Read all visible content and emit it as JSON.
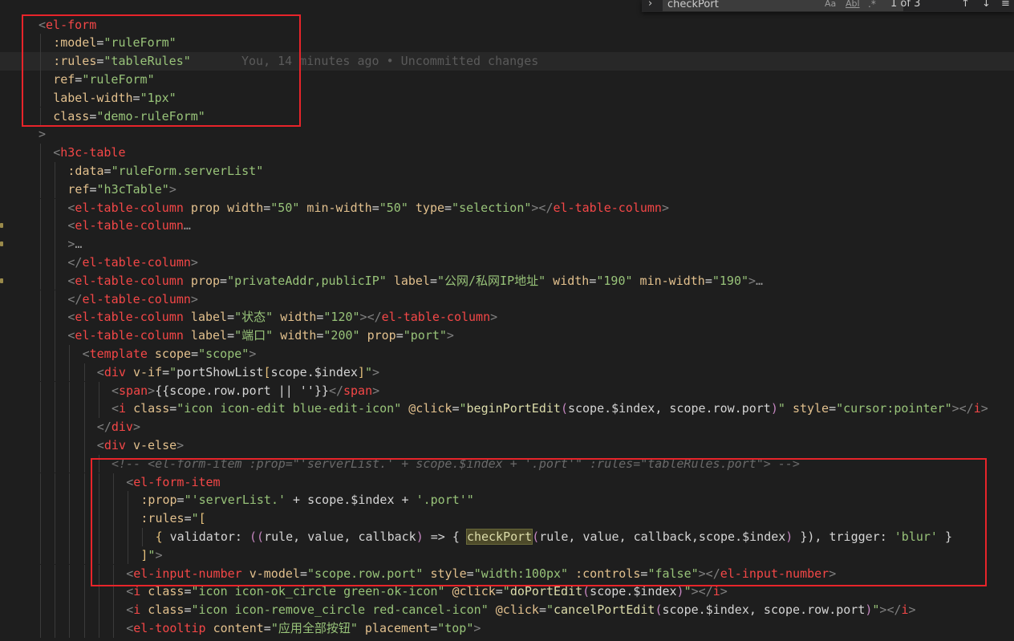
{
  "find_widget": {
    "toggle_icon": "chevron-right-icon",
    "query": "checkPort",
    "match_case_label": "Aa",
    "whole_word_label": "Abl",
    "regex_icon": "regex-icon",
    "result_count": "1 of 3",
    "prev_icon": "arrow-up-icon",
    "next_icon": "arrow-down-icon",
    "menu_icon": "hamburger-icon"
  },
  "blame": {
    "text": "You, 14 minutes ago • Uncommitted changes"
  },
  "code_lines": [
    {
      "indent": 0,
      "tokens": [
        [
          "punc",
          "<"
        ],
        [
          "tag",
          "el-form"
        ]
      ]
    },
    {
      "indent": 1,
      "tokens": [
        [
          "attr",
          ":model"
        ],
        [
          "eq",
          "="
        ],
        [
          "str",
          "\"ruleForm\""
        ]
      ]
    },
    {
      "indent": 1,
      "tokens": [
        [
          "attr",
          ":rules"
        ],
        [
          "eq",
          "="
        ],
        [
          "str",
          "\"tableRules\""
        ]
      ],
      "blame": true
    },
    {
      "indent": 1,
      "tokens": [
        [
          "attr",
          "ref"
        ],
        [
          "eq",
          "="
        ],
        [
          "str",
          "\"ruleForm\""
        ]
      ]
    },
    {
      "indent": 1,
      "tokens": [
        [
          "attr",
          "label-width"
        ],
        [
          "eq",
          "="
        ],
        [
          "str",
          "\"1px\""
        ]
      ]
    },
    {
      "indent": 1,
      "tokens": [
        [
          "attr",
          "class"
        ],
        [
          "eq",
          "="
        ],
        [
          "str",
          "\"demo-ruleForm\""
        ]
      ]
    },
    {
      "indent": 0,
      "tokens": [
        [
          "punc",
          ">"
        ]
      ]
    },
    {
      "indent": 1,
      "tokens": [
        [
          "punc",
          "<"
        ],
        [
          "tag",
          "h3c-table"
        ]
      ]
    },
    {
      "indent": 2,
      "tokens": [
        [
          "attr",
          ":data"
        ],
        [
          "eq",
          "="
        ],
        [
          "str",
          "\"ruleForm.serverList\""
        ]
      ]
    },
    {
      "indent": 2,
      "tokens": [
        [
          "attr",
          "ref"
        ],
        [
          "eq",
          "="
        ],
        [
          "str",
          "\"h3cTable\""
        ],
        [
          "punc",
          ">"
        ]
      ]
    },
    {
      "indent": 2,
      "tokens": [
        [
          "punc",
          "<"
        ],
        [
          "tag",
          "el-table-column"
        ],
        [
          "plain",
          " "
        ],
        [
          "attr",
          "prop"
        ],
        [
          "plain",
          " "
        ],
        [
          "attr",
          "width"
        ],
        [
          "eq",
          "="
        ],
        [
          "str",
          "\"50\""
        ],
        [
          "plain",
          " "
        ],
        [
          "attr",
          "min-width"
        ],
        [
          "eq",
          "="
        ],
        [
          "str",
          "\"50\""
        ],
        [
          "plain",
          " "
        ],
        [
          "attr",
          "type"
        ],
        [
          "eq",
          "="
        ],
        [
          "str",
          "\"selection\""
        ],
        [
          "punc",
          "></"
        ],
        [
          "tag",
          "el-table-column"
        ],
        [
          "punc",
          ">"
        ]
      ]
    },
    {
      "indent": 2,
      "tokens": [
        [
          "punc",
          "<"
        ],
        [
          "tag",
          "el-table-column"
        ],
        [
          "ellipsis",
          "…"
        ]
      ],
      "fold": true
    },
    {
      "indent": 2,
      "tokens": [
        [
          "punc",
          ">"
        ],
        [
          "ellipsis",
          "…"
        ]
      ],
      "fold": true
    },
    {
      "indent": 2,
      "tokens": [
        [
          "punc",
          "</"
        ],
        [
          "tag",
          "el-table-column"
        ],
        [
          "punc",
          ">"
        ]
      ]
    },
    {
      "indent": 2,
      "tokens": [
        [
          "punc",
          "<"
        ],
        [
          "tag",
          "el-table-column"
        ],
        [
          "plain",
          " "
        ],
        [
          "attr",
          "prop"
        ],
        [
          "eq",
          "="
        ],
        [
          "str",
          "\"privateAddr,publicIP\""
        ],
        [
          "plain",
          " "
        ],
        [
          "attr",
          "label"
        ],
        [
          "eq",
          "="
        ],
        [
          "str",
          "\"公网/私网IP地址\""
        ],
        [
          "plain",
          " "
        ],
        [
          "attr",
          "width"
        ],
        [
          "eq",
          "="
        ],
        [
          "str",
          "\"190\""
        ],
        [
          "plain",
          " "
        ],
        [
          "attr",
          "min-width"
        ],
        [
          "eq",
          "="
        ],
        [
          "str",
          "\"190\""
        ],
        [
          "punc",
          ">"
        ],
        [
          "ellipsis",
          "…"
        ]
      ],
      "fold": true
    },
    {
      "indent": 2,
      "tokens": [
        [
          "punc",
          "</"
        ],
        [
          "tag",
          "el-table-column"
        ],
        [
          "punc",
          ">"
        ]
      ]
    },
    {
      "indent": 2,
      "tokens": [
        [
          "punc",
          "<"
        ],
        [
          "tag",
          "el-table-column"
        ],
        [
          "plain",
          " "
        ],
        [
          "attr",
          "label"
        ],
        [
          "eq",
          "="
        ],
        [
          "str",
          "\"状态\""
        ],
        [
          "plain",
          " "
        ],
        [
          "attr",
          "width"
        ],
        [
          "eq",
          "="
        ],
        [
          "str",
          "\"120\""
        ],
        [
          "punc",
          "></"
        ],
        [
          "tag",
          "el-table-column"
        ],
        [
          "punc",
          ">"
        ]
      ]
    },
    {
      "indent": 2,
      "tokens": [
        [
          "punc",
          "<"
        ],
        [
          "tag",
          "el-table-column"
        ],
        [
          "plain",
          " "
        ],
        [
          "attr",
          "label"
        ],
        [
          "eq",
          "="
        ],
        [
          "str",
          "\"端口\""
        ],
        [
          "plain",
          " "
        ],
        [
          "attr",
          "width"
        ],
        [
          "eq",
          "="
        ],
        [
          "str",
          "\"200\""
        ],
        [
          "plain",
          " "
        ],
        [
          "attr",
          "prop"
        ],
        [
          "eq",
          "="
        ],
        [
          "str",
          "\"port\""
        ],
        [
          "punc",
          ">"
        ]
      ]
    },
    {
      "indent": 3,
      "tokens": [
        [
          "punc",
          "<"
        ],
        [
          "tag",
          "template"
        ],
        [
          "plain",
          " "
        ],
        [
          "attr",
          "scope"
        ],
        [
          "eq",
          "="
        ],
        [
          "str",
          "\"scope\""
        ],
        [
          "punc",
          ">"
        ]
      ]
    },
    {
      "indent": 4,
      "tokens": [
        [
          "punc",
          "<"
        ],
        [
          "tag",
          "div"
        ],
        [
          "plain",
          " "
        ],
        [
          "attr",
          "v-if"
        ],
        [
          "eq",
          "="
        ],
        [
          "str",
          "\""
        ],
        [
          "plain",
          "portShowList"
        ],
        [
          "hl",
          "["
        ],
        [
          "plain",
          "scope.$index"
        ],
        [
          "hl",
          "]"
        ],
        [
          "str",
          "\""
        ],
        [
          "punc",
          ">"
        ]
      ]
    },
    {
      "indent": 5,
      "tokens": [
        [
          "punc",
          "<"
        ],
        [
          "tag",
          "span"
        ],
        [
          "punc",
          ">"
        ],
        [
          "plain",
          "{{scope.row.port || ''}}"
        ],
        [
          "punc",
          "</"
        ],
        [
          "tag",
          "span"
        ],
        [
          "punc",
          ">"
        ]
      ]
    },
    {
      "indent": 5,
      "tokens": [
        [
          "punc",
          "<"
        ],
        [
          "tag",
          "i"
        ],
        [
          "plain",
          " "
        ],
        [
          "attr",
          "class"
        ],
        [
          "eq",
          "="
        ],
        [
          "str",
          "\"icon icon-edit blue-edit-icon\""
        ],
        [
          "plain",
          " "
        ],
        [
          "attr",
          "@click"
        ],
        [
          "eq",
          "="
        ],
        [
          "str",
          "\""
        ],
        [
          "fn",
          "beginPortEdit"
        ],
        [
          "paren",
          "("
        ],
        [
          "plain",
          "scope.$index, scope.row.port"
        ],
        [
          "paren",
          ")"
        ],
        [
          "str",
          "\""
        ],
        [
          "plain",
          " "
        ],
        [
          "attr",
          "style"
        ],
        [
          "eq",
          "="
        ],
        [
          "str",
          "\"cursor:pointer\""
        ],
        [
          "punc",
          "></"
        ],
        [
          "tag",
          "i"
        ],
        [
          "punc",
          ">"
        ]
      ]
    },
    {
      "indent": 4,
      "tokens": [
        [
          "punc",
          "</"
        ],
        [
          "tag",
          "div"
        ],
        [
          "punc",
          ">"
        ]
      ]
    },
    {
      "indent": 4,
      "tokens": [
        [
          "punc",
          "<"
        ],
        [
          "tag",
          "div"
        ],
        [
          "plain",
          " "
        ],
        [
          "attr",
          "v-else"
        ],
        [
          "punc",
          ">"
        ]
      ]
    },
    {
      "indent": 5,
      "tokens": [
        [
          "comment",
          "<!-- <el-form-item :prop=\"'serverList.' + scope.$index + '.port'\" :rules=\"tableRules.port\"> -->"
        ]
      ]
    },
    {
      "indent": 6,
      "tokens": [
        [
          "punc",
          "<"
        ],
        [
          "tag",
          "el-form-item"
        ]
      ]
    },
    {
      "indent": 7,
      "tokens": [
        [
          "attr",
          ":prop"
        ],
        [
          "eq",
          "="
        ],
        [
          "str",
          "\"'serverList.'"
        ],
        [
          "plain",
          " + scope.$index + "
        ],
        [
          "str",
          "'.port'\""
        ]
      ]
    },
    {
      "indent": 7,
      "tokens": [
        [
          "attr",
          ":rules"
        ],
        [
          "eq",
          "="
        ],
        [
          "str",
          "\""
        ],
        [
          "hl",
          "["
        ]
      ]
    },
    {
      "indent": 8,
      "tokens": [
        [
          "hl",
          "{ "
        ],
        [
          "plain",
          "validator: "
        ],
        [
          "paren",
          "(("
        ],
        [
          "plain",
          "rule, value, callback"
        ],
        [
          "paren",
          ")"
        ],
        [
          "plain",
          " => { "
        ],
        [
          "match",
          "checkPort"
        ],
        [
          "paren",
          "("
        ],
        [
          "plain",
          "rule, value, callback,scope.$index"
        ],
        [
          "paren",
          ")"
        ],
        [
          "plain",
          " }), trigger: "
        ],
        [
          "str",
          "'blur'"
        ],
        [
          "plain",
          " }"
        ]
      ]
    },
    {
      "indent": 7,
      "tokens": [
        [
          "hl",
          "]"
        ],
        [
          "str",
          "\""
        ],
        [
          "punc",
          ">"
        ]
      ]
    },
    {
      "indent": 6,
      "tokens": [
        [
          "punc",
          "<"
        ],
        [
          "tag",
          "el-input-number"
        ],
        [
          "plain",
          " "
        ],
        [
          "attr",
          "v-model"
        ],
        [
          "eq",
          "="
        ],
        [
          "str",
          "\"scope.row.port\""
        ],
        [
          "plain",
          " "
        ],
        [
          "attr",
          "style"
        ],
        [
          "eq",
          "="
        ],
        [
          "str",
          "\"width:100px\""
        ],
        [
          "plain",
          " "
        ],
        [
          "attr",
          ":controls"
        ],
        [
          "eq",
          "="
        ],
        [
          "str",
          "\"false\""
        ],
        [
          "punc",
          "></"
        ],
        [
          "tag",
          "el-input-number"
        ],
        [
          "punc",
          ">"
        ]
      ]
    },
    {
      "indent": 6,
      "tokens": [
        [
          "punc",
          "<"
        ],
        [
          "tag",
          "i"
        ],
        [
          "plain",
          " "
        ],
        [
          "attr",
          "class"
        ],
        [
          "eq",
          "="
        ],
        [
          "str",
          "\"icon icon-ok_circle green-ok-icon\""
        ],
        [
          "plain",
          " "
        ],
        [
          "attr",
          "@click"
        ],
        [
          "eq",
          "="
        ],
        [
          "str",
          "\""
        ],
        [
          "fn",
          "doPortEdit"
        ],
        [
          "paren",
          "("
        ],
        [
          "plain",
          "scope.$index"
        ],
        [
          "paren",
          ")"
        ],
        [
          "str",
          "\""
        ],
        [
          "punc",
          "></"
        ],
        [
          "tag",
          "i"
        ],
        [
          "punc",
          ">"
        ]
      ]
    },
    {
      "indent": 6,
      "tokens": [
        [
          "punc",
          "<"
        ],
        [
          "tag",
          "i"
        ],
        [
          "plain",
          " "
        ],
        [
          "attr",
          "class"
        ],
        [
          "eq",
          "="
        ],
        [
          "str",
          "\"icon icon-remove_circle red-cancel-icon\""
        ],
        [
          "plain",
          " "
        ],
        [
          "attr",
          "@click"
        ],
        [
          "eq",
          "="
        ],
        [
          "str",
          "\""
        ],
        [
          "fn",
          "cancelPortEdit"
        ],
        [
          "paren",
          "("
        ],
        [
          "plain",
          "scope.$index, scope.row.port"
        ],
        [
          "paren",
          ")"
        ],
        [
          "str",
          "\""
        ],
        [
          "punc",
          "></"
        ],
        [
          "tag",
          "i"
        ],
        [
          "punc",
          ">"
        ]
      ]
    },
    {
      "indent": 6,
      "tokens": [
        [
          "punc",
          "<"
        ],
        [
          "tag",
          "el-tooltip"
        ],
        [
          "plain",
          " "
        ],
        [
          "attr",
          "content"
        ],
        [
          "eq",
          "="
        ],
        [
          "str",
          "\"应用全部按钮\""
        ],
        [
          "plain",
          " "
        ],
        [
          "attr",
          "placement"
        ],
        [
          "eq",
          "="
        ],
        [
          "str",
          "\"top\""
        ],
        [
          "punc",
          ">"
        ]
      ]
    }
  ],
  "colors": {
    "background": "#1e1e1e",
    "tag": "#f44747",
    "attribute": "#e2c08d",
    "string": "#98c379",
    "annotation_box": "#e8242a"
  }
}
